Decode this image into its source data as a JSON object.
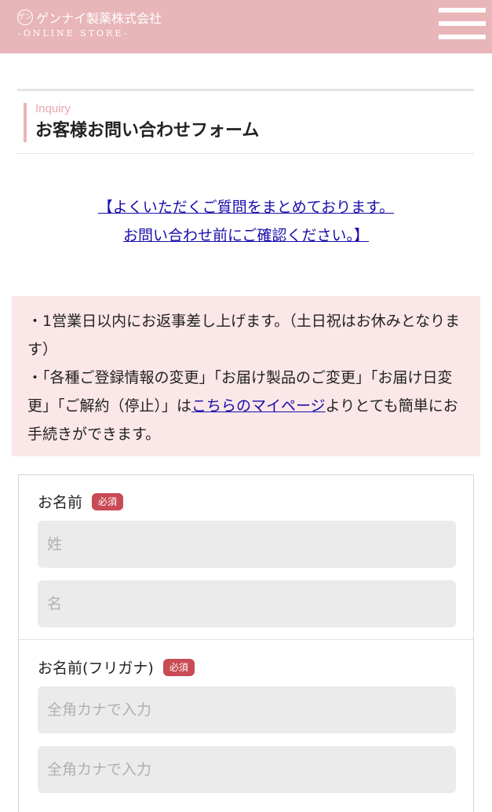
{
  "header": {
    "logo_mark": "ゲン",
    "brand_name": "ゲンナイ製薬株式会社",
    "brand_sub": "-ONLINE STORE-",
    "bg_color": "#e8b5b9"
  },
  "page": {
    "subtitle": "Inquiry",
    "title": "お客様お問い合わせフォーム"
  },
  "faq_link": {
    "line1": "【よくいただくご質問をまとめております。",
    "line2": "お問い合わせ前にご確認ください。】"
  },
  "notice": {
    "line1": "・1営業日以内にお返事差し上げます。（土日祝はお休みとなります）",
    "line2_before": "・「各種ご登録情報の変更」「お届け製品のご変更」「お届け日変更」「ご解約（停止）」は",
    "line2_link": "こちらのマイページ",
    "line2_after": "よりとても簡単にお手続きができます。",
    "bg_color": "#fbe7e8"
  },
  "form": {
    "name": {
      "label": "お名前",
      "required": "必須",
      "last_placeholder": "姓",
      "first_placeholder": "名"
    },
    "kana": {
      "label": "お名前(フリガナ)",
      "required": "必須",
      "last_placeholder": "全角カナで入力",
      "first_placeholder": "全角カナで入力"
    }
  }
}
